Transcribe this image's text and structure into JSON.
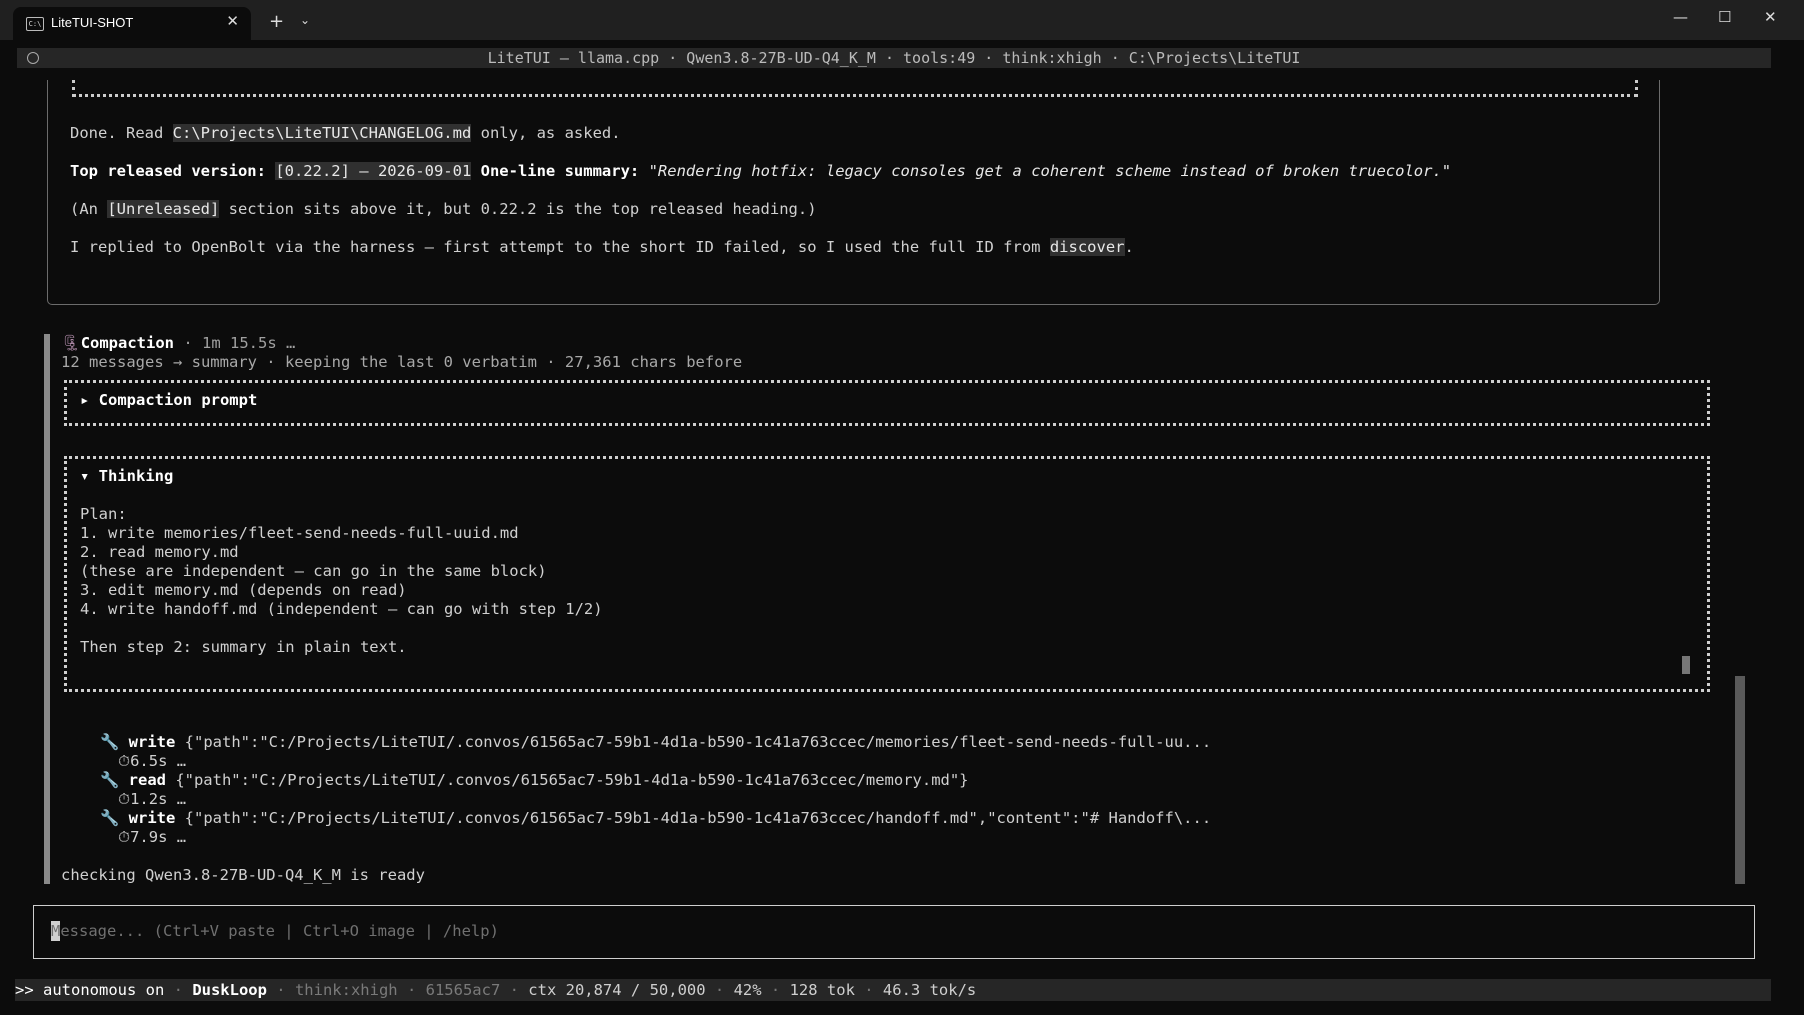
{
  "window": {
    "tab_title": "LiteTUI-SHOT",
    "tab_icon": "C:\\",
    "tab_close": "✕",
    "new_tab": "+",
    "dropdown": "⌄",
    "minimize": "—",
    "maximize": "☐",
    "close": "✕"
  },
  "header": {
    "text": "LiteTUI — llama.cpp · Qwen3.8-27B-UD-Q4_K_M · tools:49 · think:xhigh · C:\\Projects\\LiteTUI"
  },
  "previous": {
    "l1_pre": "Done. Read ",
    "l1_code": "C:\\Projects\\LiteTUI\\CHANGELOG.md",
    "l1_post": " only, as asked.",
    "l2_label": "Top released version: ",
    "l2_code": "[0.22.2] — 2026-09-01",
    "l2_label2": " One-line summary: ",
    "l2_quote": "\"Rendering hotfix: legacy consoles get a coherent scheme instead of broken truecolor.\"",
    "l3_pre": "(An ",
    "l3_code": "[Unreleased]",
    "l3_post": " section sits above it, but 0.22.2 is the top released heading.)",
    "l4_pre": "I replied to OpenBolt via the harness — first attempt to the short ID failed, so I used the full ID from ",
    "l4_code": "discover",
    "l4_post": "."
  },
  "compaction": {
    "icon": "🗜",
    "title": "Compaction",
    "meta": " · 1m 15.5s …",
    "summary": "12 messages → summary · keeping the last 0 verbatim · 27,361 chars before",
    "prompt_toggle": "▸ Compaction prompt",
    "thinking_toggle": "▾ Thinking",
    "thinking_lines": [
      "Plan:",
      "1. write memories/fleet-send-needs-full-uuid.md",
      "2. read memory.md",
      "(these are independent — can go in the same block)",
      "3. edit memory.md (depends on read)",
      "4. write handoff.md (independent — can go with step 1/2)",
      "",
      "Then step 2: summary in plain text."
    ]
  },
  "tools": [
    {
      "icon": "🔧",
      "name": "write",
      "args": " {\"path\":\"C:/Projects/LiteTUI/.convos/61565ac7-59b1-4d1a-b590-1c41a763ccec/memories/fleet-send-needs-full-uu...",
      "timer": "⏱6.5s …"
    },
    {
      "icon": "🔧",
      "name": "read",
      "args": " {\"path\":\"C:/Projects/LiteTUI/.convos/61565ac7-59b1-4d1a-b590-1c41a763ccec/memory.md\"}",
      "timer": "⏱1.2s …"
    },
    {
      "icon": "🔧",
      "name": "write",
      "args": " {\"path\":\"C:/Projects/LiteTUI/.convos/61565ac7-59b1-4d1a-b590-1c41a763ccec/handoff.md\",\"content\":\"# Handoff\\...",
      "timer": "⏱7.9s …"
    }
  ],
  "status_message": "checking Qwen3.8-27B-UD-Q4_K_M is ready",
  "input": {
    "placeholder": "Message... (Ctrl+V paste | Ctrl+O image | /help)",
    "value": ""
  },
  "status_bar": {
    "autonomous": ">> autonomous on",
    "sep": " · ",
    "agent": "DuskLoop",
    "think": "think:xhigh",
    "session": "61565ac7",
    "ctx": "ctx 20,874 / 50,000",
    "pct": "42%",
    "tok": "128 tok",
    "rate": "46.3 tok/s"
  },
  "colors": {
    "background": "#0c0c0c",
    "chrome": "#202020",
    "status_bar": "#262626",
    "accent_purple": "#b48ead"
  }
}
